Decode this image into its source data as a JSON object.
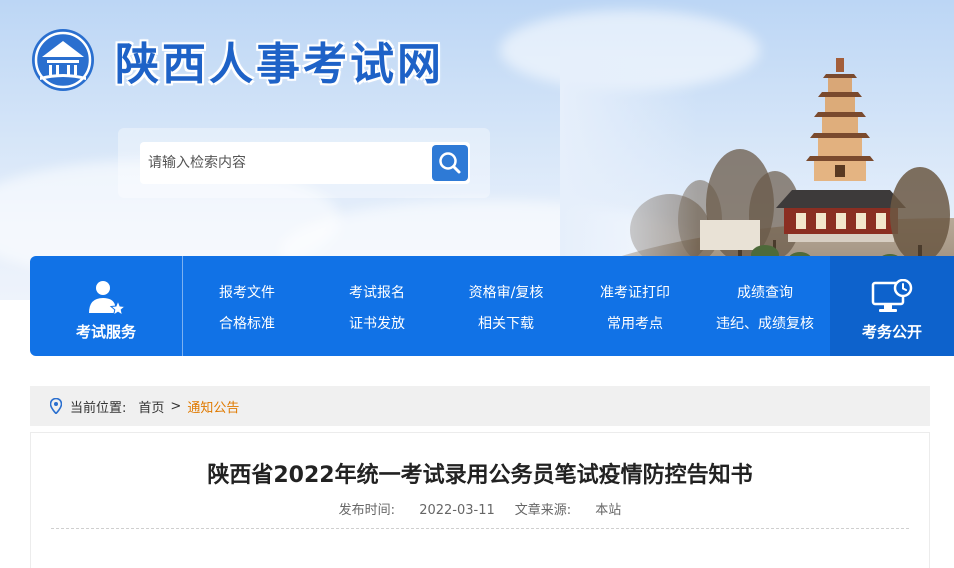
{
  "header": {
    "site_title": "陕西人事考试网",
    "logo_icon": "pagoda-emblem-icon",
    "search": {
      "placeholder": "请输入检索内容",
      "button_icon": "search-icon"
    }
  },
  "nav": {
    "left": {
      "label": "考试服务",
      "icon": "user-star-icon"
    },
    "links": [
      {
        "label": "报考文件"
      },
      {
        "label": "考试报名"
      },
      {
        "label": "资格审/复核"
      },
      {
        "label": "准考证打印"
      },
      {
        "label": "成绩查询"
      },
      {
        "label": "合格标准"
      },
      {
        "label": "证书发放"
      },
      {
        "label": "相关下载"
      },
      {
        "label": "常用考点"
      },
      {
        "label": "违纪、成绩复核"
      }
    ],
    "right": {
      "label": "考务公开",
      "icon": "monitor-clock-icon"
    }
  },
  "breadcrumb": {
    "icon": "location-pin-icon",
    "prefix": "当前位置:",
    "home": "首页",
    "separator": ">",
    "current": "通知公告"
  },
  "article": {
    "title": "陕西省2022年统一考试录用公务员笔试疫情防控告知书",
    "publish_label": "发布时间:",
    "publish_date": "2022-03-11",
    "source_label": "文章来源:",
    "source": "本站"
  },
  "colors": {
    "brand_blue": "#1172e6",
    "title_blue": "#1e62c7",
    "accent_orange": "#e07a00"
  }
}
